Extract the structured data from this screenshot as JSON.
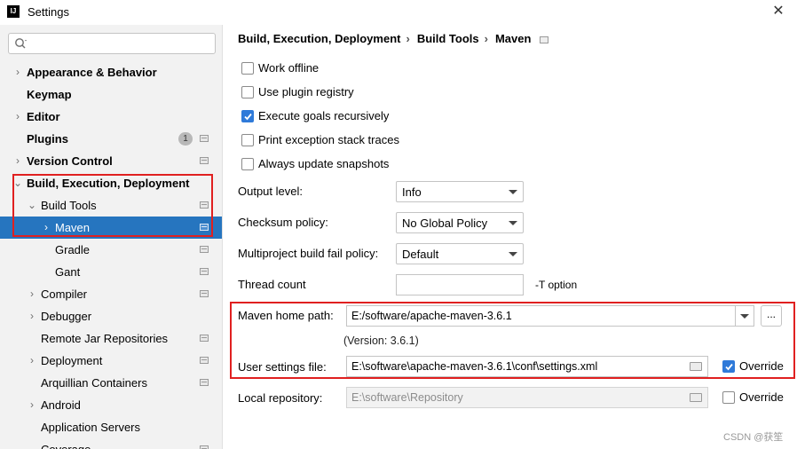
{
  "window": {
    "title": "Settings",
    "logo_text": "IJ"
  },
  "search": {
    "placeholder": ""
  },
  "sidebar": {
    "items": [
      {
        "label": "Appearance & Behavior"
      },
      {
        "label": "Keymap"
      },
      {
        "label": "Editor"
      },
      {
        "label": "Plugins",
        "badge": "1"
      },
      {
        "label": "Version Control"
      },
      {
        "label": "Build, Execution, Deployment"
      },
      {
        "label": "Build Tools"
      },
      {
        "label": "Maven"
      },
      {
        "label": "Gradle"
      },
      {
        "label": "Gant"
      },
      {
        "label": "Compiler"
      },
      {
        "label": "Debugger"
      },
      {
        "label": "Remote Jar Repositories"
      },
      {
        "label": "Deployment"
      },
      {
        "label": "Arquillian Containers"
      },
      {
        "label": "Android"
      },
      {
        "label": "Application Servers"
      },
      {
        "label": "Coverage"
      }
    ]
  },
  "breadcrumb": {
    "parts": [
      "Build, Execution, Deployment",
      "Build Tools",
      "Maven"
    ],
    "separator": "›"
  },
  "options": [
    {
      "label": "Work offline",
      "checked": false
    },
    {
      "label": "Use plugin registry",
      "checked": false
    },
    {
      "label": "Execute goals recursively",
      "checked": true
    },
    {
      "label": "Print exception stack traces",
      "checked": false
    },
    {
      "label": "Always update snapshots",
      "checked": false
    }
  ],
  "settings": {
    "output_level": {
      "label": "Output level:",
      "value": "Info"
    },
    "checksum_policy": {
      "label": "Checksum policy:",
      "value": "No Global Policy"
    },
    "fail_policy": {
      "label": "Multiproject build fail policy:",
      "value": "Default"
    },
    "thread_count": {
      "label": "Thread count",
      "value": "",
      "hint": "-T option"
    },
    "maven_home": {
      "label": "Maven home path:",
      "value": "E:/software/apache-maven-3.6.1",
      "version": "(Version: 3.6.1)",
      "browse": "..."
    },
    "user_settings": {
      "label": "User settings file:",
      "value": "E:\\software\\apache-maven-3.6.1\\conf\\settings.xml",
      "override_label": "Override",
      "override": true
    },
    "local_repo": {
      "label": "Local repository:",
      "value": "E:\\software\\Repository",
      "override_label": "Override",
      "override": false
    }
  },
  "watermark": "CSDN @获笙",
  "colors": {
    "selection": "#2675bf",
    "highlight_box": "#e02020",
    "checkbox_on": "#2f7ad9"
  }
}
